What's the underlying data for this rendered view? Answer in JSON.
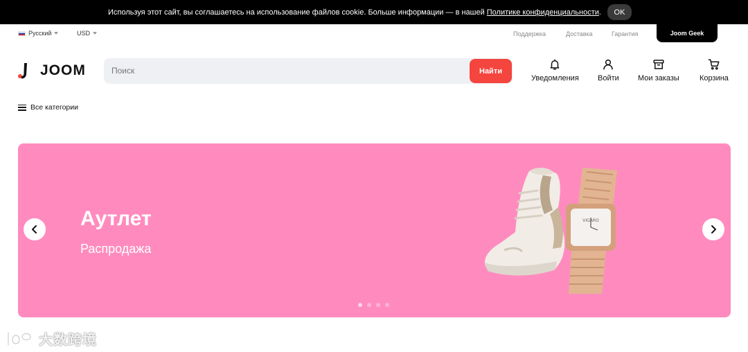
{
  "cookie_bar": {
    "text": "Используя этот сайт, вы соглашаетесь на использование файлов cookie. Больше информации — в нашей",
    "link": "Политике конфиденциальности",
    "end": ".",
    "ok_label": "OK"
  },
  "topbar": {
    "language": "Русский",
    "currency": "USD",
    "links": [
      "Поддержка",
      "Доставка",
      "Гарантия"
    ],
    "geek_label": "Joom Geek"
  },
  "header": {
    "logo": "JOOM",
    "search_placeholder": "Поиск",
    "search_button": "Найти",
    "notifications": "Уведомления",
    "login": "Войти",
    "orders": "Мои заказы",
    "cart": "Корзина"
  },
  "categories_label": "Все категории",
  "banner": {
    "title": "Аутлет",
    "subtitle": "Распродажа",
    "background": "#ff8bbe",
    "slides": 4,
    "active_slide": 1
  },
  "watermark": "大数跨境",
  "colors": {
    "accent": "#f4453e",
    "cookie_bg": "#000000",
    "banner_bg": "#ff8bbe",
    "search_bg": "#eef0f3"
  }
}
